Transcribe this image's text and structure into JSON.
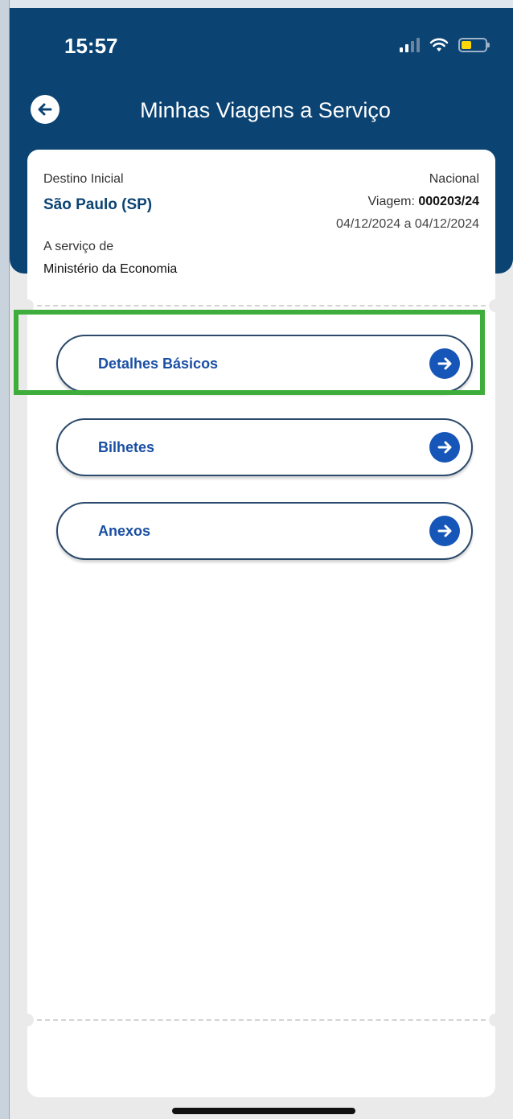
{
  "status_bar": {
    "time": "15:57"
  },
  "header": {
    "title": "Minhas Viagens a Serviço"
  },
  "trip_card": {
    "destination_label": "Destino Inicial",
    "destination_value": "São Paulo (SP)",
    "scope": "Nacional",
    "trip_label": "Viagem: ",
    "trip_number": "000203/24",
    "dates": "04/12/2024 a 04/12/2024",
    "service_label": "A serviço de",
    "service_value": "Ministério da Economia"
  },
  "menu": {
    "items": [
      {
        "label": "Detalhes Básicos"
      },
      {
        "label": "Bilhetes"
      },
      {
        "label": "Anexos"
      }
    ]
  },
  "colors": {
    "header_bg": "#0b4373",
    "accent_blue": "#1656b8",
    "highlight_green": "#3fad3b"
  }
}
